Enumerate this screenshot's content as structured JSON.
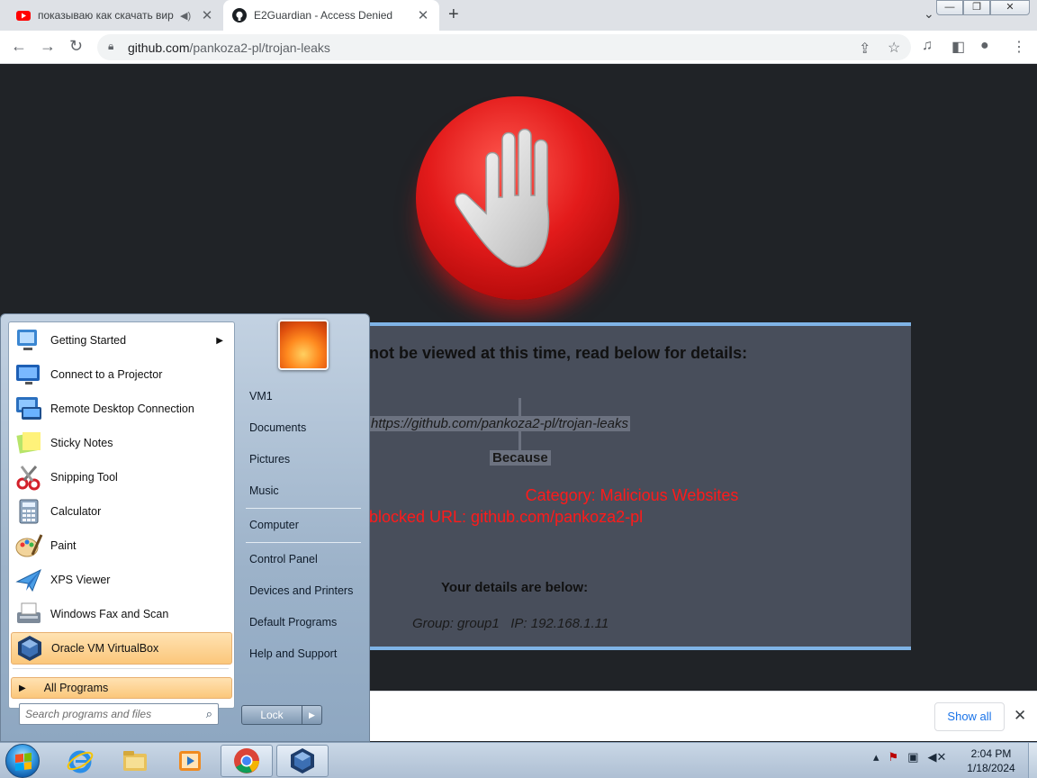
{
  "browser": {
    "tabs": [
      {
        "title": "показываю как скачать вир",
        "favicon": "youtube-icon",
        "audio": true
      },
      {
        "title": "E2Guardian - Access Denied",
        "favicon": "github-icon",
        "active": true
      }
    ],
    "window_buttons": {
      "minimize": "—",
      "restore": "❐",
      "close": "✕"
    },
    "url": {
      "host": "github.com",
      "path": "/pankoza2-pl/trojan-leaks"
    }
  },
  "page": {
    "heading": "not be viewed at this time, read below for details:",
    "blocked_url": "https://github.com/pankoza2-pl/trojan-leaks",
    "because": "Because",
    "category": "Category: Malicious Websites",
    "blocked_reason": "blocked URL: github.com/pankoza2-pl",
    "details_heading": "Your details are below:",
    "details": "Group: group1   IP: 192.168.1.11"
  },
  "download_bar": {
    "show_all": "Show all",
    "close": "✕"
  },
  "start_menu": {
    "programs": [
      {
        "label": "Getting Started",
        "icon": "getting-started-icon",
        "submenu": true
      },
      {
        "label": "Connect to a Projector",
        "icon": "projector-icon"
      },
      {
        "label": "Remote Desktop Connection",
        "icon": "remote-desktop-icon"
      },
      {
        "label": "Sticky Notes",
        "icon": "sticky-notes-icon"
      },
      {
        "label": "Snipping Tool",
        "icon": "snipping-tool-icon"
      },
      {
        "label": "Calculator",
        "icon": "calculator-icon"
      },
      {
        "label": "Paint",
        "icon": "paint-icon"
      },
      {
        "label": "XPS Viewer",
        "icon": "xps-viewer-icon"
      },
      {
        "label": "Windows Fax and Scan",
        "icon": "fax-scan-icon"
      },
      {
        "label": "Oracle VM VirtualBox",
        "icon": "virtualbox-icon",
        "highlighted": true
      }
    ],
    "all_programs": "All Programs",
    "search_placeholder": "Search programs and files",
    "right_links": [
      "VM1",
      "Documents",
      "Pictures",
      "Music",
      "Computer",
      "Control Panel",
      "Devices and Printers",
      "Default Programs",
      "Help and Support"
    ],
    "lock_button": "Lock"
  },
  "taskbar": {
    "items": [
      "internet-explorer-icon",
      "file-explorer-icon",
      "media-player-icon",
      "chrome-icon",
      "virtualbox-icon"
    ],
    "clock": {
      "time": "2:04 PM",
      "date": "1/18/2024"
    }
  },
  "colors": {
    "accent_red": "#ff1a1a",
    "panel_border": "#7fb3e6",
    "menu_highlight": "#fbc77b"
  }
}
